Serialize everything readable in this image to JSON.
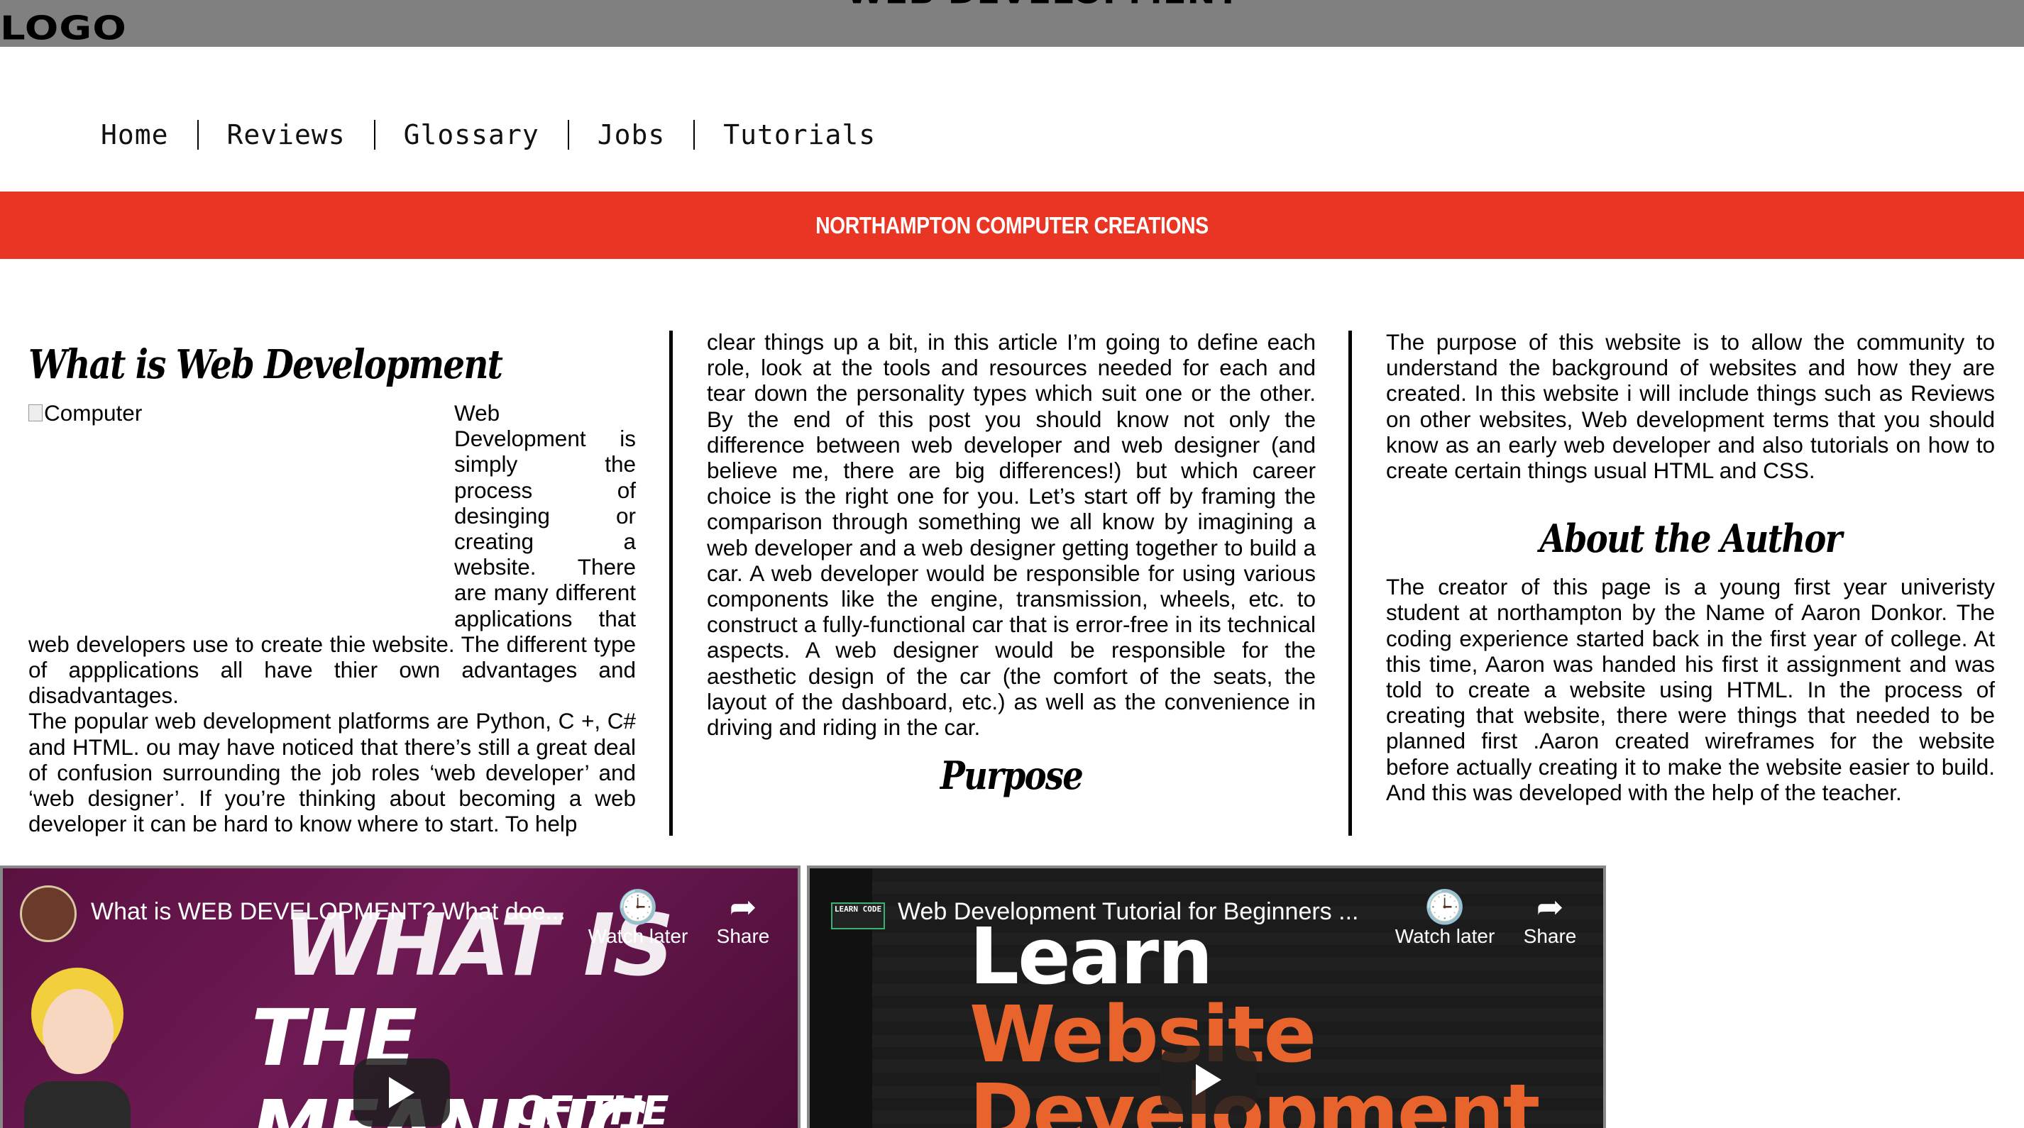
{
  "header": {
    "logo": "LOGO",
    "title": "WEB DEVELOPMENT"
  },
  "nav": {
    "items": [
      {
        "label": "Home"
      },
      {
        "label": "Reviews"
      },
      {
        "label": "Glossary"
      },
      {
        "label": "Jobs"
      },
      {
        "label": "Tutorials"
      }
    ]
  },
  "banner": {
    "text": "NORTHAMPTON COMPUTER CREATIONS"
  },
  "col1": {
    "heading": "What is Web Development",
    "image_alt": "Computer",
    "intro": "Web Development is simply the process of desinging or creating a website. There are many different applications that web developers use to create thie website. The different type of appplications all have thier own advantages and disadvantages.",
    "body": "The popular web development platforms are Python, C +, C# and HTML. ou may have noticed that there’s still a great deal of confusion surrounding the job roles ‘web developer’ and ‘web designer’. If you’re thinking about becoming a web developer it can be hard to know where to start. To help"
  },
  "col2": {
    "body": "clear things up a bit, in this article I’m going to define each role, look at the tools and resources needed for each and tear down the personality types which suit one or the other. By the end of this post you should know not only the difference between web developer and web designer (and believe me, there are big differences!) but which career choice is the right one for you. Let’s start off by framing the comparison through something we all know by imagining a web developer and a web designer getting together to build a car. A web developer would be responsible for using various components like the engine, transmission, wheels, etc. to construct a fully-functional car that is error-free in its technical aspects. A web designer would be responsible for the aesthetic design of the car (the comfort of the seats, the layout of the dashboard, etc.) as well as the convenience in driving and riding in the car.",
    "heading": "Purpose"
  },
  "col3": {
    "purpose_text": "The purpose of this website is to allow the community to understand the background of websites and how they are created. In this website i will include things such as Reviews on other websites, Web development terms that you should know as an early web developer and also tutorials on how to create certain things usual HTML and CSS.",
    "heading": "About the Author",
    "author_text": "The creator of this page is a young first year univeristy student at northampton by the Name of Aaron Donkor. The coding experience started back in the first year of college. At this time, Aaron was handed his first it assignment and was told to create a website using HTML. In the process of creating that website, there were things that needed to be planned first .Aaron created wireframes for the website before actually creating it to make the website easier to build. And this was developed with the help of the teacher."
  },
  "videos": [
    {
      "title": "What is WEB DEVELOPMENT? What doe...",
      "watch_later": "Watch later",
      "share": "Share",
      "thumb_line1": "WHAT IS",
      "thumb_line2": "THE MEANING",
      "thumb_line3": "OF THE TERM"
    },
    {
      "title": "Web Development Tutorial for Beginners ...",
      "watch_later": "Watch later",
      "share": "Share",
      "badge": "LEARN CODE",
      "thumb_line1": "Learn",
      "thumb_line2": "Website",
      "thumb_line3": "Development"
    }
  ],
  "colors": {
    "topbar": "#808080",
    "banner": "#e83524",
    "accent_orange": "#e8642c"
  }
}
